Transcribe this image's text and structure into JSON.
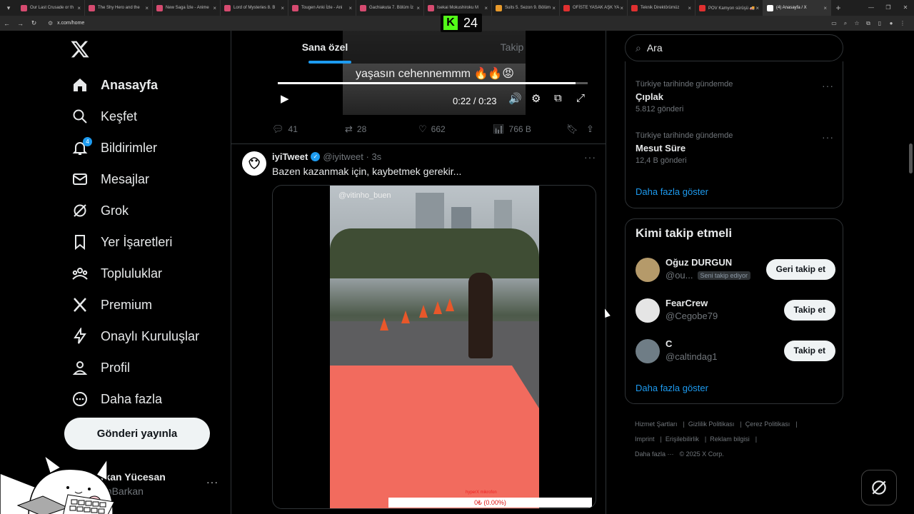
{
  "browser": {
    "tabs": [
      {
        "label": "Our Last Crusade or th",
        "color": "#d64b70"
      },
      {
        "label": "The Shy Hero and the ",
        "color": "#d64b70"
      },
      {
        "label": "New Saga İzle - Anime",
        "color": "#d64b70"
      },
      {
        "label": "Lord of Mysteries 8. B",
        "color": "#d64b70"
      },
      {
        "label": "Tougen Anki İzle - Ani",
        "color": "#d64b70"
      },
      {
        "label": "Gachiakuta 7. Bölüm İz",
        "color": "#d64b70"
      },
      {
        "label": "Isekai Mokushiroku M",
        "color": "#d64b70"
      },
      {
        "label": "Suits 5. Sezon 9. Bölüm",
        "color": "#e89a2b"
      },
      {
        "label": "OFİSTE YASAK AŞK YA",
        "color": "#e03030"
      },
      {
        "label": "Teknik Direktörümüz ",
        "color": "#e03030"
      },
      {
        "label": "POV Kamyon sürüşü 🚚",
        "color": "#e03030"
      },
      {
        "label": "(4) Anasayfa / X",
        "color": "#ffffff"
      }
    ],
    "url": "x.com/home",
    "kick_count": "24"
  },
  "sidebar": {
    "items": [
      {
        "label": "Anasayfa",
        "icon": "home-icon"
      },
      {
        "label": "Keşfet",
        "icon": "search-icon"
      },
      {
        "label": "Bildirimler",
        "icon": "bell-icon",
        "badge": "4"
      },
      {
        "label": "Mesajlar",
        "icon": "mail-icon"
      },
      {
        "label": "Grok",
        "icon": "grok-icon"
      },
      {
        "label": "Yer İşaretleri",
        "icon": "bookmark-icon"
      },
      {
        "label": "Topluluklar",
        "icon": "communities-icon"
      },
      {
        "label": "Premium",
        "icon": "x-premium-icon"
      },
      {
        "label": "Onaylı Kuruluşlar",
        "icon": "lightning-icon"
      },
      {
        "label": "Profil",
        "icon": "person-icon"
      },
      {
        "label": "Daha fazla",
        "icon": "more-circle-icon"
      }
    ],
    "post_button": "Gönderi yayınla",
    "profile_name": "rkan Yücesan",
    "profile_handle": "anBarkan"
  },
  "timeline": {
    "tab_for_you": "Sana özel",
    "tab_following": "Takip",
    "video1": {
      "caption": "yaşasın cehennemmm 🔥🔥😡",
      "time": "0:22 / 0:23",
      "progress": 0.96
    },
    "tweet1_actions": {
      "replies": "41",
      "reposts": "28",
      "likes": "662",
      "views": "766 B"
    },
    "tweet2": {
      "name": "iyiTweet",
      "handle": "@iyitweet · 3s",
      "text": "Bazen kazanmak için, kaybetmek gerekir...",
      "video_tag": "@vitinho_buen",
      "counter": "0₺ (0.00%)",
      "counter_label": "hyperX mikrofon"
    }
  },
  "right": {
    "search_placeholder": "Ara",
    "trends": [
      {
        "context": "Türkiye tarihinde gündemde",
        "name": "Çıplak",
        "count": "5.812 gönderi"
      },
      {
        "context": "Türkiye tarihinde gündemde",
        "name": "Mesut Süre",
        "count": "12,4 B gönderi"
      }
    ],
    "trends_show_more": "Daha fazla göster",
    "who_to_follow_title": "Kimi takip etmeli",
    "users": [
      {
        "name": "Oğuz DURGUN",
        "handle": "@ou...",
        "follows_you": "Seni takip ediyor",
        "button": "Geri takip et"
      },
      {
        "name": "FearCrew",
        "handle": "@Cegobe79",
        "follows_you": "",
        "button": "Takip et"
      },
      {
        "name": "C",
        "handle": "@caltindag1",
        "follows_you": "",
        "button": "Takip et"
      }
    ],
    "wtf_show_more": "Daha fazla göster",
    "footer": {
      "terms": "Hizmet Şartları",
      "privacy": "Gizlilik Politikası",
      "cookies": "Çerez Politikası",
      "imprint": "Imprint",
      "accessibility": "Erişilebilirlik",
      "ads": "Reklam bilgisi",
      "more": "Daha fazla ···",
      "copyright": "© 2025 X Corp."
    }
  },
  "colors": {
    "accent": "#1d9bf0",
    "background": "#000000",
    "border": "#2f3336",
    "muted_text": "#71767b"
  }
}
